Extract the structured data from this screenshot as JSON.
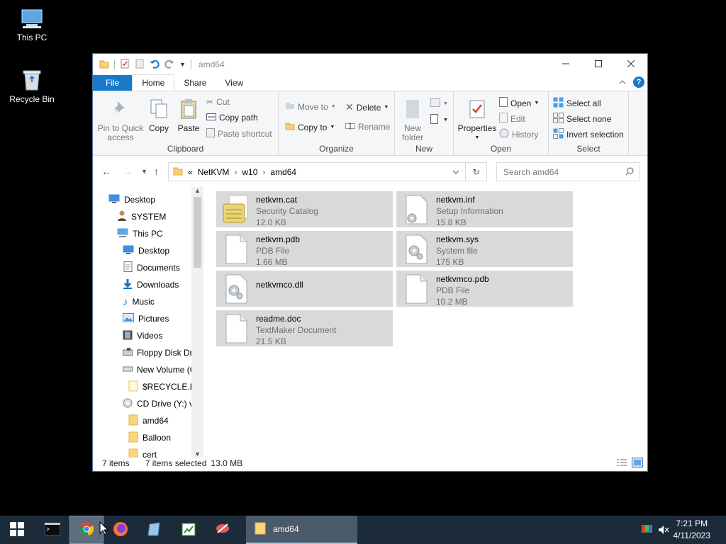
{
  "desktop": {
    "icons": [
      {
        "label": "This PC",
        "icon": "computer-icon"
      },
      {
        "label": "Recycle Bin",
        "icon": "recycle-bin-icon"
      }
    ]
  },
  "window": {
    "title": "amd64",
    "tabs": [
      "File",
      "Home",
      "Share",
      "View"
    ],
    "active_tab": "Home"
  },
  "ribbon": {
    "clipboard": {
      "pin_label": "Pin to Quick access",
      "copy_label": "Copy",
      "paste_label": "Paste",
      "cut_label": "Cut",
      "copy_path_label": "Copy path",
      "paste_shortcut_label": "Paste shortcut",
      "group_label": "Clipboard"
    },
    "organize": {
      "move_to_label": "Move to",
      "copy_to_label": "Copy to",
      "delete_label": "Delete",
      "rename_label": "Rename",
      "group_label": "Organize"
    },
    "new": {
      "new_folder_label": "New folder",
      "group_label": "New"
    },
    "open": {
      "properties_label": "Properties",
      "open_label": "Open",
      "edit_label": "Edit",
      "history_label": "History",
      "group_label": "Open"
    },
    "select": {
      "select_all_label": "Select all",
      "select_none_label": "Select none",
      "invert_label": "Invert selection",
      "group_label": "Select"
    }
  },
  "address": {
    "overflow": "«",
    "breadcrumbs": [
      "NetKVM",
      "w10",
      "amd64"
    ],
    "search_placeholder": "Search amd64"
  },
  "navpane": {
    "items": [
      {
        "label": "Desktop",
        "icon": "desktop-icon"
      },
      {
        "label": "SYSTEM",
        "icon": "user-icon"
      },
      {
        "label": "This PC",
        "icon": "computer-icon"
      },
      {
        "label": "Desktop",
        "icon": "desktop-icon"
      },
      {
        "label": "Documents",
        "icon": "documents-icon"
      },
      {
        "label": "Downloads",
        "icon": "downloads-icon"
      },
      {
        "label": "Music",
        "icon": "music-icon"
      },
      {
        "label": "Pictures",
        "icon": "pictures-icon"
      },
      {
        "label": "Videos",
        "icon": "videos-icon"
      },
      {
        "label": "Floppy Disk Dri",
        "icon": "floppy-icon"
      },
      {
        "label": "New Volume (C",
        "icon": "drive-icon"
      },
      {
        "label": "$RECYCLE.BIN",
        "icon": "folder-icon"
      },
      {
        "label": "CD Drive (Y:) vi",
        "icon": "cd-drive-icon"
      },
      {
        "label": "amd64",
        "icon": "folder-icon"
      },
      {
        "label": "Balloon",
        "icon": "folder-icon"
      },
      {
        "label": "cert",
        "icon": "folder-icon"
      }
    ]
  },
  "files": [
    {
      "name": "netkvm.cat",
      "type": "Security Catalog",
      "size": "12.0 KB",
      "icon": "catalog-file-icon"
    },
    {
      "name": "netkvm.inf",
      "type": "Setup Information",
      "size": "15.8 KB",
      "icon": "setup-file-icon"
    },
    {
      "name": "netkvm.pdb",
      "type": "PDB File",
      "size": "1.66 MB",
      "icon": "blank-file-icon"
    },
    {
      "name": "netkvm.sys",
      "type": "System file",
      "size": "175 KB",
      "icon": "system-file-icon"
    },
    {
      "name": "netkvmco.dll",
      "type": "",
      "size": "",
      "icon": "dll-file-icon"
    },
    {
      "name": "netkvmco.pdb",
      "type": "PDB File",
      "size": "10.2 MB",
      "icon": "blank-file-icon"
    },
    {
      "name": "readme.doc",
      "type": "TextMaker Document",
      "size": "21.5 KB",
      "icon": "blank-file-icon"
    }
  ],
  "status": {
    "item_count": "7 items",
    "selected": "7 items selected",
    "size": "13.0 MB"
  },
  "taskbar": {
    "window_label": "amd64",
    "time": "7:21 PM",
    "date": "4/11/2023"
  }
}
